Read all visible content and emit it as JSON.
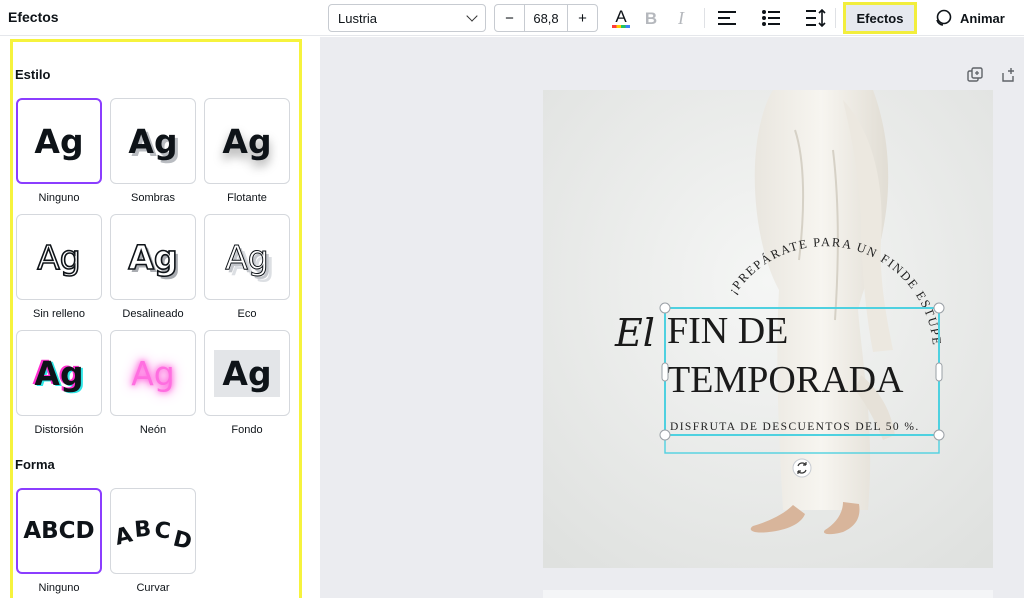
{
  "panel": {
    "title": "Efectos",
    "style_section": "Estilo",
    "style_tiles": [
      {
        "label": "Ninguno",
        "sample": "Ag",
        "selected": true
      },
      {
        "label": "Sombras",
        "sample": "Ag"
      },
      {
        "label": "Flotante",
        "sample": "Ag"
      },
      {
        "label": "Sin relleno",
        "sample": "Ag"
      },
      {
        "label": "Desalineado",
        "sample": "Ag"
      },
      {
        "label": "Eco",
        "sample": "Ag"
      },
      {
        "label": "Distorsión",
        "sample": "Ag"
      },
      {
        "label": "Neón",
        "sample": "Ag"
      },
      {
        "label": "Fondo",
        "sample": "Ag"
      }
    ],
    "shape_section": "Forma",
    "shape_tiles": [
      {
        "label": "Ninguno",
        "sample": "ABCD",
        "selected": true
      },
      {
        "label": "Curvar",
        "sample": "ABCD"
      }
    ]
  },
  "toolbar": {
    "font": "Lustria",
    "font_size": "68,8",
    "minus": "−",
    "plus": "+",
    "effects_label": "Efectos",
    "animate_label": "Animar",
    "icons": [
      "text-color-icon",
      "bold-icon",
      "italic-icon",
      "align-left-icon",
      "list-icon",
      "spacing-icon"
    ]
  },
  "canvas": {
    "arc_text": "¡PREPÁRATE PARA UN FINDE ESTUPENDO!",
    "script_word": "El",
    "headline_line1": "FIN DE",
    "headline_line2": "TEMPORADA",
    "subline": "DISFRUTA DE DESCUENTOS DEL 50 %."
  },
  "colors": {
    "selection": "#8b3dff",
    "highlight": "#f6f33d",
    "text_frame": "#4fd1e0",
    "neon": "#ff4fd8"
  }
}
